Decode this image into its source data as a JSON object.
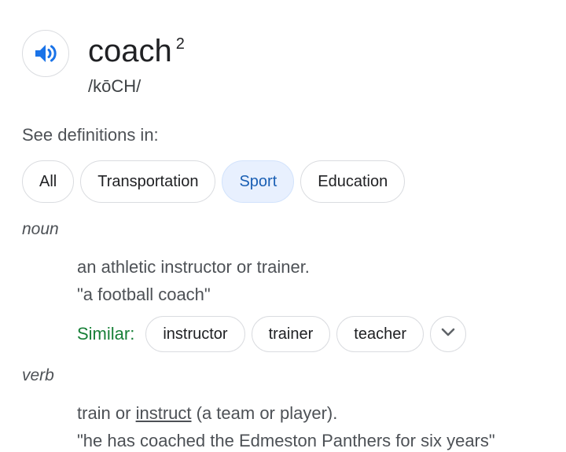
{
  "entry": {
    "word": "coach",
    "superscript": "2",
    "phonetic": "/kōCH/",
    "audio_icon": "speaker-icon"
  },
  "see_definitions": {
    "label": "See definitions in:",
    "chips": [
      {
        "label": "All",
        "selected": false
      },
      {
        "label": "Transportation",
        "selected": false
      },
      {
        "label": "Sport",
        "selected": true
      },
      {
        "label": "Education",
        "selected": false
      }
    ]
  },
  "senses": [
    {
      "part_of_speech": "noun",
      "definition": "an athletic instructor or trainer.",
      "example": "\"a football coach\"",
      "similar": {
        "label": "Similar:",
        "words": [
          "instructor",
          "trainer",
          "teacher"
        ],
        "expand_icon": "chevron-down-icon"
      }
    },
    {
      "part_of_speech": "verb",
      "definition_before": "train or ",
      "definition_link": "instruct",
      "definition_after": " (a team or player).",
      "example": "\"he has coached the Edmeston Panthers for six years\""
    }
  ],
  "colors": {
    "accent_blue": "#1a73e8",
    "similar_green": "#188038",
    "selected_chip_bg": "#e8f0fe"
  }
}
